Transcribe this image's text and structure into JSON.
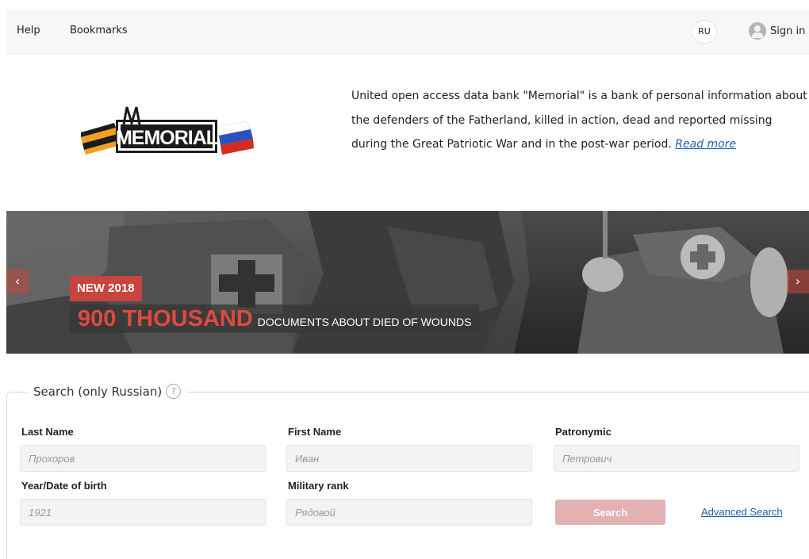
{
  "nav": {
    "help": "Help",
    "bookmarks": "Bookmarks",
    "lang": "RU",
    "sign_in": "Sign in"
  },
  "logo": {
    "text": "MEMORIAL"
  },
  "intro": {
    "text": "United open access data bank \"Memorial\" is a bank of personal information about the defenders of the Fatherland, killed in action, dead and reported missing during the Great Patriotic War and in the post-war period. ",
    "read_more": "Read more"
  },
  "banner": {
    "badge": "NEW 2018",
    "headline_big": "900 THOUSAND",
    "headline_small": "DOCUMENTS ABOUT DIED OF WOUNDS",
    "prev": "‹",
    "next": "›"
  },
  "search": {
    "legend": "Search (only Russian)",
    "help": "?",
    "last_name": {
      "label": "Last Name",
      "placeholder": "Прохоров"
    },
    "first_name": {
      "label": "First Name",
      "placeholder": "Иван"
    },
    "patronymic": {
      "label": "Patronymic",
      "placeholder": "Петрович"
    },
    "birth": {
      "label": "Year/Date of birth",
      "placeholder": "1921"
    },
    "rank": {
      "label": "Military rank",
      "placeholder": "Рядовой"
    },
    "button": "Search",
    "advanced": "Advanced Search"
  },
  "colors": {
    "accent_red": "#c8443e",
    "link_blue": "#1f5fa8",
    "search_button": "#e3b1b1"
  }
}
